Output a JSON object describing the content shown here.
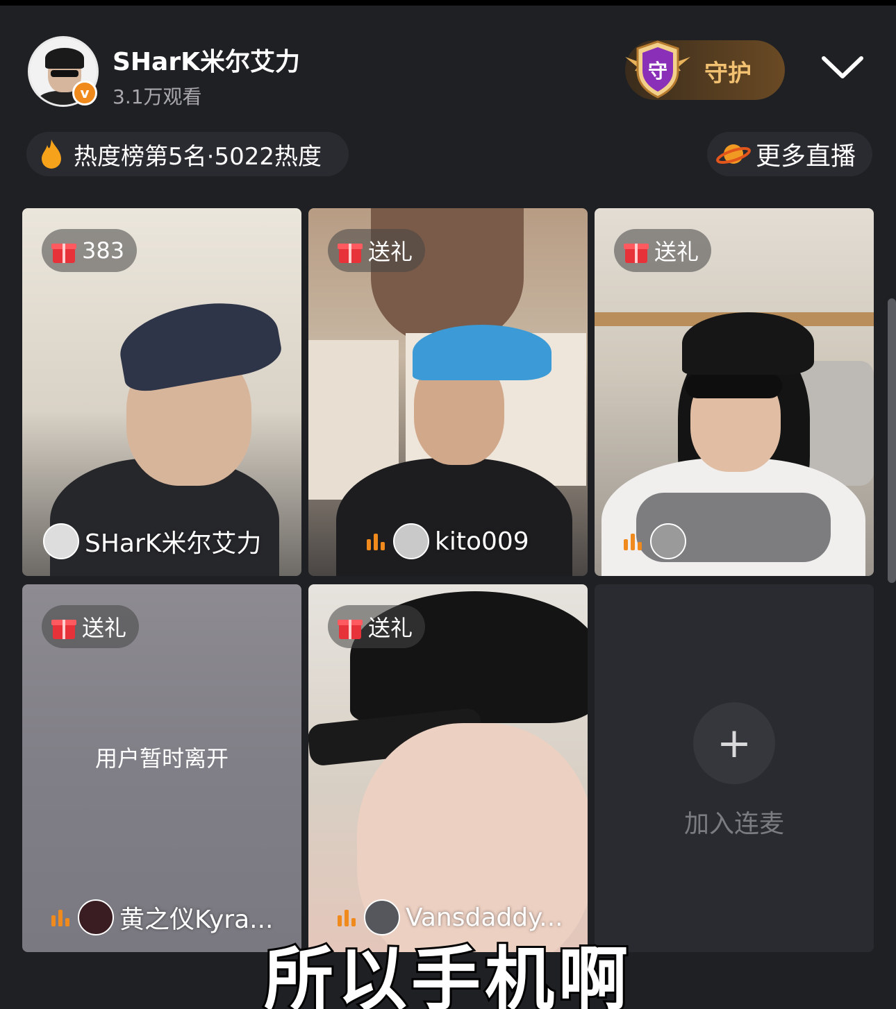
{
  "header": {
    "host_name": "SHarK米尔艾力",
    "viewers": "3.1万观看",
    "verified_mark": "v",
    "guard_icon_text": "守",
    "guard_label": "守护"
  },
  "heat": {
    "rank_text": "热度榜第5名·5022热度",
    "more_live": "更多直播"
  },
  "tiles": [
    {
      "gift": "383",
      "user": "SHarK米尔艾力"
    },
    {
      "gift": "送礼",
      "user": "kito009"
    },
    {
      "gift": "送礼",
      "user": ""
    },
    {
      "gift": "送礼",
      "user": "黄之仪Kyra...",
      "status": "用户暂时离开"
    },
    {
      "gift": "送礼",
      "user": "Vansdaddy..."
    },
    {
      "join_label": "加入连麦",
      "join_icon": "+"
    }
  ],
  "subtitle": "所以手机啊",
  "colors": {
    "background": "#1f2024",
    "guard_gold": "#f2c071",
    "sound_orange": "#f08a1c",
    "gift_red": "#e8323a"
  },
  "icons": [
    "flame-icon",
    "planet-icon",
    "gift-icon",
    "sound-level-icon",
    "chevron-down-icon",
    "plus-icon",
    "shield-icon"
  ]
}
